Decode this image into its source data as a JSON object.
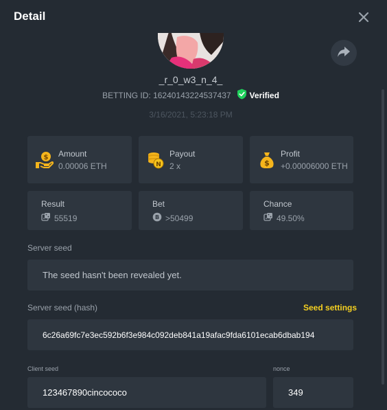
{
  "header": {
    "title": "Detail"
  },
  "user": {
    "username": "_r_0_w3_n_4_"
  },
  "bet": {
    "id_label": "BETTING ID: 16240143224537437",
    "verified_label": "Verified",
    "date": "3/16/2021, 5:23:18 PM"
  },
  "stats": {
    "amount": {
      "label": "Amount",
      "value": "0.00006 ETH"
    },
    "payout": {
      "label": "Payout",
      "value": "2 x"
    },
    "profit": {
      "label": "Profit",
      "value": "+0.00006000 ETH"
    },
    "result": {
      "label": "Result",
      "value": "55519"
    },
    "bet": {
      "label": "Bet",
      "value": ">50499"
    },
    "chance": {
      "label": "Chance",
      "value": "49.50%"
    }
  },
  "server_seed": {
    "label": "Server seed",
    "value": "The seed hasn't been revealed yet."
  },
  "server_seed_hash": {
    "label": "Server seed (hash)",
    "settings_link": "Seed settings",
    "value": "6c26a69fc7e3ec592b6f3e984c092deb841a19afac9fda6101ecab6dbab194"
  },
  "client_seed": {
    "label": "Client seed",
    "value": "123467890cincococo"
  },
  "nonce": {
    "label": "nonce",
    "value": "349"
  },
  "colors": {
    "accent": "#f5d020",
    "verified": "#1fd05b",
    "background": "#242b33",
    "card": "#2e363f"
  },
  "icons": [
    "close-icon",
    "share-icon",
    "verified-shield-icon",
    "coin-hand-icon",
    "coins-stack-icon",
    "money-bag-icon",
    "dice-icon",
    "bet-chip-icon"
  ]
}
